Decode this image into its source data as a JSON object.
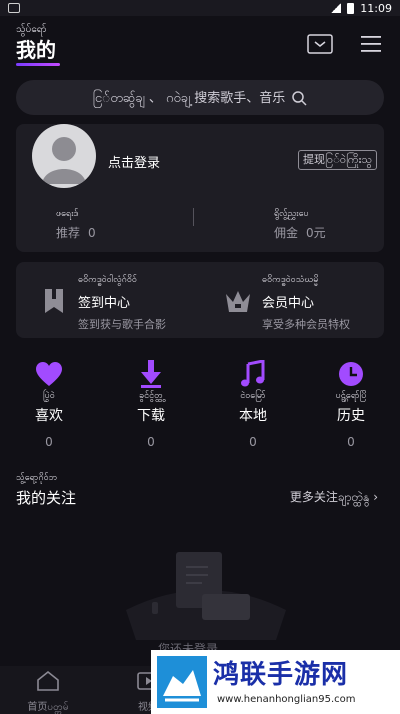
{
  "status_bar": {
    "time": "11:09"
  },
  "header": {
    "title_small": "သွ်ပ်ရော်",
    "title": "我的"
  },
  "search": {
    "placeholder": "ငြ်တဆွ်ချ  、 ဂဝဲချ့ 搜索歌手、音乐"
  },
  "user_card": {
    "login": "点击登录",
    "withdraw": "提现ဝြ်ဝဲကြိုးသွ",
    "stats": [
      {
        "small": "ဖရေးဒ်",
        "label": "推荐",
        "value": "0"
      },
      {
        "small": "ရွိလွ့်ညွှးပေ",
        "label": "佣金",
        "value": "0元"
      }
    ]
  },
  "services": [
    {
      "small": "ဓဝိကဒ္ဓဝဲဝါလွံဂ်ဝိဝ်",
      "title": "签到中心",
      "sub": "签到获与歌手合影",
      "icon": "bookmark-icon"
    },
    {
      "small": "ဓဝိကဒ္ဓဝဲဝသံဃမ္မိ",
      "title": "会员中心",
      "sub": "享受多种会员特权",
      "icon": "crown-icon"
    }
  ],
  "shortcuts": [
    {
      "small": "ပြွဲဝဲ",
      "label": "喜欢",
      "count": "0",
      "icon": "heart-icon"
    },
    {
      "small": "ခွင်ငွ်တ္ထွ",
      "label": "下载",
      "count": "0",
      "icon": "download-icon"
    },
    {
      "small": "ငဲဝမြော်",
      "label": "本地",
      "count": "0",
      "icon": "music-note-icon"
    },
    {
      "small": "ပဠ္ဂ်ရော်ပြိ",
      "label": "历史",
      "count": "0",
      "icon": "clock-icon"
    }
  ],
  "follow": {
    "small": "သွ့်ရော့ဂိုဝ်ဘ",
    "title": "我的关注",
    "more": "更多关注ချာ့တ္ထဲနွ"
  },
  "empty_text": "您还未登录",
  "tabs": [
    {
      "label": "首页ပတ္တမ်",
      "icon": "home-icon"
    },
    {
      "label": "视频",
      "icon": "video-icon"
    }
  ],
  "watermark": {
    "title": "鸿联手游网",
    "url": "www.henanhonglian95.com"
  },
  "colors": {
    "accent": "#a24bff",
    "background": "#111016",
    "card": "#1e1d24"
  }
}
